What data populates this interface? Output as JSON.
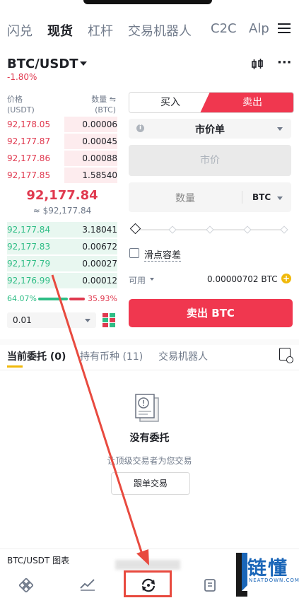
{
  "top_tabs": [
    "闪兑",
    "现货",
    "杠杆",
    "交易机器人",
    "C2C",
    "Alp"
  ],
  "active_tab_index": 1,
  "pair": "BTC/USDT",
  "change": "-1.80%",
  "orderbook": {
    "price_header_1": "价格",
    "price_header_2": "(USDT)",
    "qty_header_1": "数量 ⇋",
    "qty_header_2": "(BTC)",
    "asks": [
      {
        "price": "92,178.05",
        "qty": "0.00006",
        "depth": 0.48
      },
      {
        "price": "92,177.87",
        "qty": "0.00045",
        "depth": 0.48
      },
      {
        "price": "92,177.86",
        "qty": "0.00088",
        "depth": 0.48
      },
      {
        "price": "92,177.85",
        "qty": "1.58540",
        "depth": 0.48
      }
    ],
    "last_price": "92,177.84",
    "last_price_usd": "≈ $92,177.84",
    "bids": [
      {
        "price": "92,177.84",
        "qty": "3.18041",
        "depth": 1.0
      },
      {
        "price": "92,177.83",
        "qty": "0.00672",
        "depth": 1.0
      },
      {
        "price": "92,177.79",
        "qty": "0.00027",
        "depth": 1.0
      },
      {
        "price": "92,176.99",
        "qty": "0.00012",
        "depth": 1.0
      }
    ],
    "buy_ratio": "64.07%",
    "sell_ratio": "35.93%",
    "precision": "0.01"
  },
  "form": {
    "buy_label": "买入",
    "sell_label": "卖出",
    "order_type": "市价单",
    "market_price_placeholder": "市价",
    "qty_placeholder": "数量",
    "qty_unit": "BTC",
    "slippage_label": "滑点容差",
    "available_label": "可用",
    "available_value": "0.00000702 BTC",
    "submit_label": "卖出 BTC"
  },
  "orders_tabs": [
    "当前委托 (0)",
    "持有币种 (11)",
    "交易机器人"
  ],
  "empty": {
    "title": "没有委托",
    "subtitle": "让顶级交易者为您交易",
    "button": "跟单交易"
  },
  "chart_bar_label": "BTC/USDT 图表",
  "watermark": {
    "main": "链懂",
    "sub": "NEATDOWN.COM"
  },
  "colors": {
    "sell": "#f0374f",
    "buy": "#2ebd85",
    "accent": "#f0b90b",
    "annotation": "#e84a3f"
  }
}
